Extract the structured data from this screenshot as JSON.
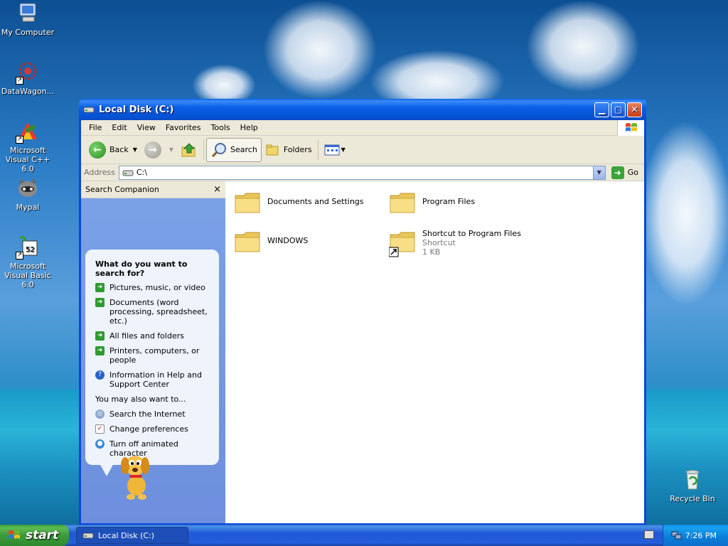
{
  "desktop": {
    "icons": [
      {
        "label": "My Computer"
      },
      {
        "label": "DataWagon..."
      },
      {
        "label": "Microsoft Visual C++ 6.0"
      },
      {
        "label": "Mypal"
      },
      {
        "label": "Microsoft Visual Basic 6.0"
      },
      {
        "label": "Recycle Bin"
      }
    ]
  },
  "window": {
    "title": "Local Disk (C:)",
    "menu": [
      "File",
      "Edit",
      "View",
      "Favorites",
      "Tools",
      "Help"
    ],
    "toolbar": {
      "back": "Back",
      "search": "Search",
      "folders": "Folders"
    },
    "address": {
      "label": "Address",
      "value": "C:\\",
      "go": "Go"
    },
    "sidebar": {
      "title": "Search Companion",
      "close": "×",
      "question": "What do you want to search for?",
      "options": [
        "Pictures, music, or video",
        "Documents (word processing, spreadsheet, etc.)",
        "All files and folders",
        "Printers, computers, or people",
        "Information in Help and Support Center"
      ],
      "also_label": "You may also want to...",
      "also_options": [
        "Search the Internet",
        "Change preferences",
        "Turn off animated character"
      ]
    },
    "files": [
      {
        "name": "Documents and Settings",
        "type": "",
        "size": ""
      },
      {
        "name": "Program Files",
        "type": "",
        "size": ""
      },
      {
        "name": "WINDOWS",
        "type": "",
        "size": ""
      },
      {
        "name": "Shortcut to Program Files",
        "type": "Shortcut",
        "size": "1 KB"
      }
    ]
  },
  "taskbar": {
    "start": "start",
    "task": "Local Disk (C:)",
    "clock": "7:26 PM"
  },
  "colors": {
    "title_blue": "#0a5ee8",
    "sidebar_blue": "#7ba2e7",
    "start_green": "#3c9a3c"
  }
}
